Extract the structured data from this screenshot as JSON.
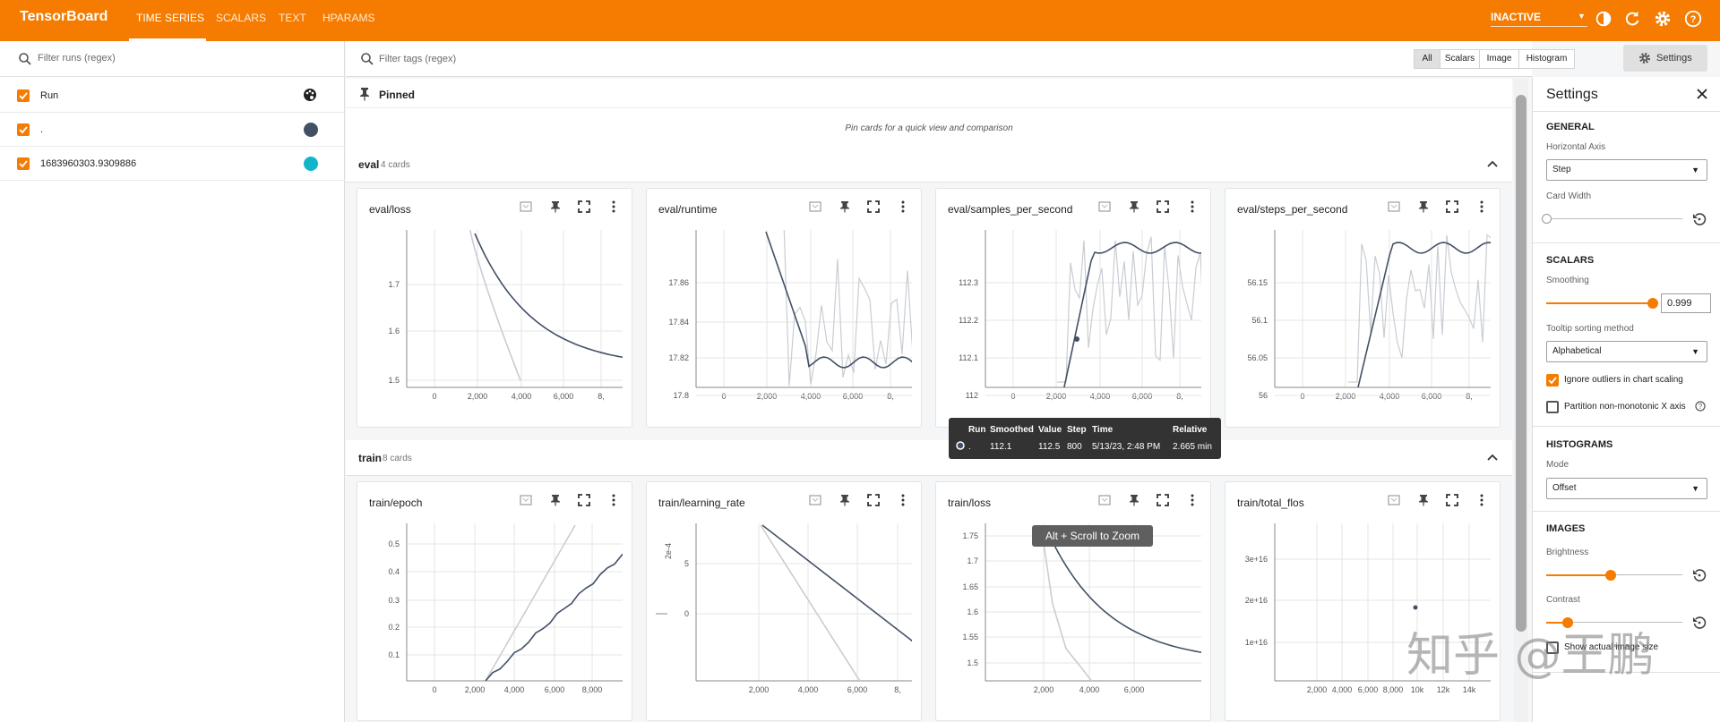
{
  "header": {
    "brand": "TensorBoard",
    "tabs": [
      "TIME SERIES",
      "SCALARS",
      "TEXT",
      "HPARAMS"
    ],
    "active_tab": "TIME SERIES",
    "status": "INACTIVE",
    "accent": "#f57c00"
  },
  "runs_pane": {
    "filter_placeholder": "Filter runs (regex)",
    "header_label": "Run",
    "runs": [
      {
        "name": ".",
        "color": "#425066"
      },
      {
        "name": "1683960303.9309886",
        "color": "#12b5cb"
      }
    ]
  },
  "tags_bar": {
    "filter_placeholder": "Filter tags (regex)",
    "filters": [
      "All",
      "Scalars",
      "Image",
      "Histogram"
    ],
    "selected": "All",
    "settings_label": "Settings"
  },
  "pinned": {
    "label": "Pinned",
    "empty_text": "Pin cards for a quick view and comparison"
  },
  "groups": [
    {
      "name": "eval",
      "count_text": "4 cards",
      "cards": [
        {
          "title": "eval/loss",
          "chart_data": {
            "type": "line",
            "x_ticks": [
              "0",
              "2,000",
              "4,000",
              "6,000",
              "8,"
            ],
            "y_ticks": [
              "1.7",
              "1.6",
              "1.5"
            ]
          }
        },
        {
          "title": "eval/runtime",
          "chart_data": {
            "type": "line",
            "x_ticks": [
              "0",
              "2,000",
              "4,000",
              "6,000",
              "8,"
            ],
            "y_ticks": [
              "17.86",
              "17.84",
              "17.82",
              "17.8"
            ]
          }
        },
        {
          "title": "eval/samples_per_second",
          "chart_data": {
            "type": "line",
            "x_ticks": [
              "0",
              "2,000",
              "4,000",
              "6,000",
              "8,"
            ],
            "y_ticks": [
              "112.3",
              "112.2",
              "112.1",
              "112"
            ]
          }
        },
        {
          "title": "eval/steps_per_second",
          "chart_data": {
            "type": "line",
            "x_ticks": [
              "0",
              "2,000",
              "4,000",
              "6,000",
              "8,"
            ],
            "y_ticks": [
              "56.15",
              "56.1",
              "56.05",
              "56"
            ]
          }
        }
      ]
    },
    {
      "name": "train",
      "count_text": "8 cards",
      "cards": [
        {
          "title": "train/epoch",
          "chart_data": {
            "type": "line",
            "x_ticks": [
              "0",
              "2,000",
              "4,000",
              "6,000",
              "8,000"
            ],
            "y_ticks": [
              "0.5",
              "0.4",
              "0.3",
              "0.2",
              "0.1"
            ]
          }
        },
        {
          "title": "train/learning_rate",
          "chart_data": {
            "type": "line",
            "x_ticks": [
              "2,000",
              "4,000",
              "6,000",
              "8,"
            ],
            "y_ticks": [
              "5",
              "0"
            ],
            "y_axis_label": "2e-4"
          }
        },
        {
          "title": "train/loss",
          "chart_data": {
            "type": "line",
            "x_ticks": [
              "2,000",
              "4,000",
              "6,000"
            ],
            "y_ticks": [
              "1.75",
              "1.7",
              "1.65",
              "1.6",
              "1.55",
              "1.5"
            ]
          }
        },
        {
          "title": "train/total_flos",
          "chart_data": {
            "type": "scatter",
            "x_ticks": [
              "2,000",
              "4,000",
              "6,000",
              "8,000",
              "10k",
              "12k",
              "14k"
            ],
            "y_ticks": [
              "3e+16",
              "2e+16",
              "1e+16"
            ]
          }
        }
      ]
    }
  ],
  "tooltip": {
    "headers": [
      "Run",
      "Smoothed",
      "Value",
      "Step",
      "Time",
      "Relative"
    ],
    "row": [
      ".",
      "112.1",
      "112.5",
      "800",
      "5/13/23, 2:48 PM",
      "2.665 min"
    ]
  },
  "zoom_hint": "Alt + Scroll to Zoom",
  "settings": {
    "title": "Settings",
    "general": "GENERAL",
    "horizontal_axis_label": "Horizontal Axis",
    "horizontal_axis_value": "Step",
    "card_width_label": "Card Width",
    "scalars": "SCALARS",
    "smoothing_label": "Smoothing",
    "smoothing_value": "0.999",
    "tooltip_sort_label": "Tooltip sorting method",
    "tooltip_sort_value": "Alphabetical",
    "ignore_outliers_label": "Ignore outliers in chart scaling",
    "partition_label": "Partition non-monotonic X axis",
    "histograms": "HISTOGRAMS",
    "mode_label": "Mode",
    "mode_value": "Offset",
    "images": "IMAGES",
    "brightness_label": "Brightness",
    "contrast_label": "Contrast",
    "show_actual_label": "Show actual image size"
  },
  "watermark": "知乎 @王鹏"
}
